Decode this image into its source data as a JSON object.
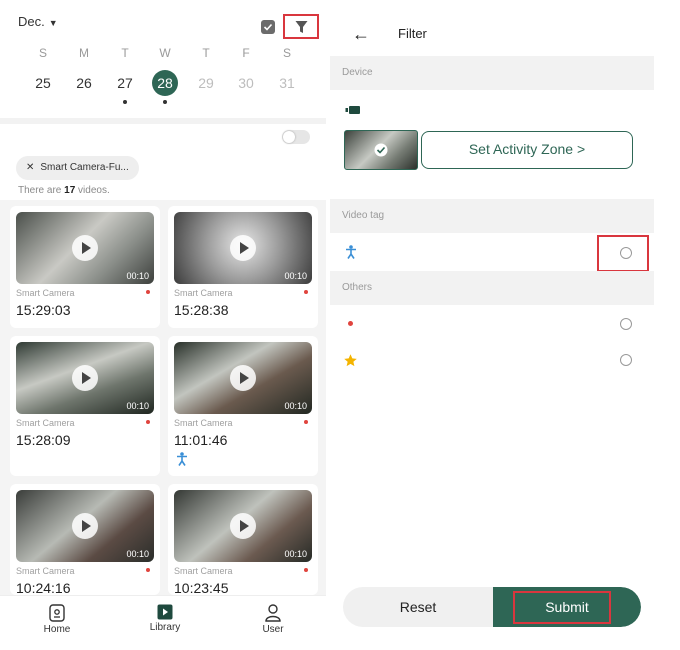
{
  "left": {
    "month": "Dec.",
    "weekdays": [
      "S",
      "M",
      "T",
      "W",
      "T",
      "F",
      "S"
    ],
    "days": [
      "25",
      "26",
      "27",
      "28",
      "29",
      "30",
      "31"
    ],
    "chip": "Smart Camera-Fu...",
    "count_prefix": "There are ",
    "count_value": "17",
    "count_suffix": " videos.",
    "videos": [
      {
        "camera": "Smart Camera",
        "time": "15:29:03",
        "duration": "00:10"
      },
      {
        "camera": "Smart Camera",
        "time": "15:28:38",
        "duration": "00:10"
      },
      {
        "camera": "Smart Camera",
        "time": "15:28:09",
        "duration": "00:10"
      },
      {
        "camera": "Smart Camera",
        "time": "11:01:46",
        "duration": "00:10"
      },
      {
        "camera": "Smart Camera",
        "time": "10:24:16",
        "duration": "00:10"
      },
      {
        "camera": "Smart Camera",
        "time": "10:23:45",
        "duration": "00:10"
      }
    ],
    "nav": {
      "home": "Home",
      "library": "Library",
      "user": "User"
    }
  },
  "right": {
    "title": "Filter",
    "device_section": "Device",
    "zone_button": "Set Activity Zone >",
    "video_tag_section": "Video tag",
    "others_section": "Others",
    "reset": "Reset",
    "submit": "Submit"
  },
  "colors": {
    "accent": "#2e6655",
    "highlight": "#d9363e",
    "dot": "#e0443e",
    "star": "#f4b400",
    "person": "#3a8fd6"
  }
}
